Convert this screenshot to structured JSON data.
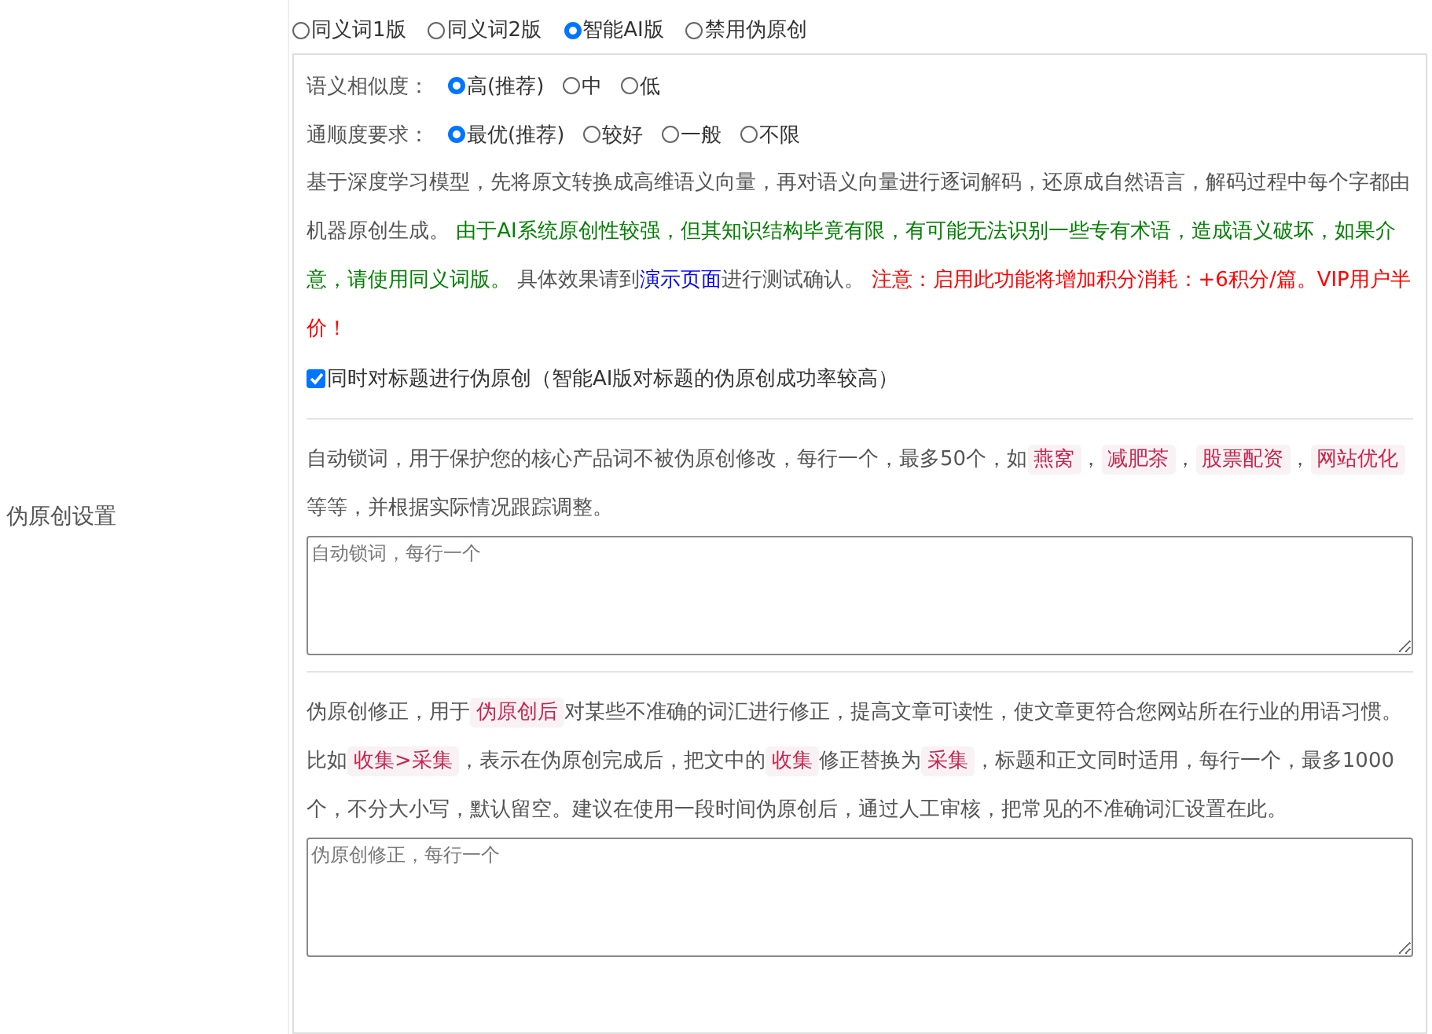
{
  "section_label": "伪原创设置",
  "mode_options": [
    {
      "label": "同义词1版",
      "selected": false
    },
    {
      "label": "同义词2版",
      "selected": false
    },
    {
      "label": "智能AI版",
      "selected": true
    },
    {
      "label": "禁用伪原创",
      "selected": false
    }
  ],
  "similarity": {
    "label": "语义相似度：",
    "options": [
      {
        "label": "高(推荐)",
        "selected": true
      },
      {
        "label": "中",
        "selected": false
      },
      {
        "label": "低",
        "selected": false
      }
    ]
  },
  "fluency": {
    "label": "通顺度要求：",
    "options": [
      {
        "label": "最优(推荐)",
        "selected": true
      },
      {
        "label": "较好",
        "selected": false
      },
      {
        "label": "一般",
        "selected": false
      },
      {
        "label": "不限",
        "selected": false
      }
    ]
  },
  "ai_description": [
    {
      "kind": "plain",
      "text": "基于深度学习模型，先将原文转换成高维语义向量，再对语义向量进行逐词解码，还原成自然语言，解码过程中每个字都由机器原创生成。 "
    },
    {
      "kind": "green",
      "text": "由于AI系统原创性较强，但其知识结构毕竟有限，有可能无法识别一些专有术语，造成语义破坏，如果介意，请使用同义词版。"
    },
    {
      "kind": "plain",
      "text": " 具体效果请到"
    },
    {
      "kind": "link",
      "text": "演示页面"
    },
    {
      "kind": "plain",
      "text": "进行测试确认。 "
    },
    {
      "kind": "warning",
      "text": "注意：启用此功能将增加积分消耗：+6积分/篇。VIP用户半价！"
    }
  ],
  "title_option": {
    "label": "同时对标题进行伪原创（智能AI版对标题的伪原创成功率较高）",
    "checked": true
  },
  "lock_words": {
    "description": [
      {
        "kind": "plain",
        "text": "自动锁词，用于保护您的核心产品词不被伪原创修改，每行一个，最多50个，如"
      },
      {
        "kind": "code",
        "text": "燕窝"
      },
      {
        "kind": "plain",
        "text": "，"
      },
      {
        "kind": "code",
        "text": "减肥茶"
      },
      {
        "kind": "plain",
        "text": "，"
      },
      {
        "kind": "code",
        "text": "股票配资"
      },
      {
        "kind": "plain",
        "text": "，"
      },
      {
        "kind": "code",
        "text": "网站优化"
      },
      {
        "kind": "plain",
        "text": " 等等，并根据实际情况跟踪调整。"
      }
    ],
    "placeholder": "自动锁词，每行一个"
  },
  "corrections": {
    "description": [
      {
        "kind": "plain",
        "text": "伪原创修正，用于"
      },
      {
        "kind": "code",
        "text": "伪原创后"
      },
      {
        "kind": "plain",
        "text": "对某些不准确的词汇进行修正，提高文章可读性，使文章更符合您网站所在行业的用语习惯。比如"
      },
      {
        "kind": "code",
        "text": "收集>采集"
      },
      {
        "kind": "plain",
        "text": "，表示在伪原创完成后，把文中的"
      },
      {
        "kind": "code",
        "text": "收集"
      },
      {
        "kind": "plain",
        "text": "修正替换为"
      },
      {
        "kind": "code",
        "text": "采集"
      },
      {
        "kind": "plain",
        "text": "，标题和正文同时适用，每行一个，最多1000个，不分大小写，默认留空。建议在使用一段时间伪原创后，通过人工审核，把常见的不准确词汇设置在此。"
      }
    ],
    "placeholder": "伪原创修正，每行一个"
  }
}
